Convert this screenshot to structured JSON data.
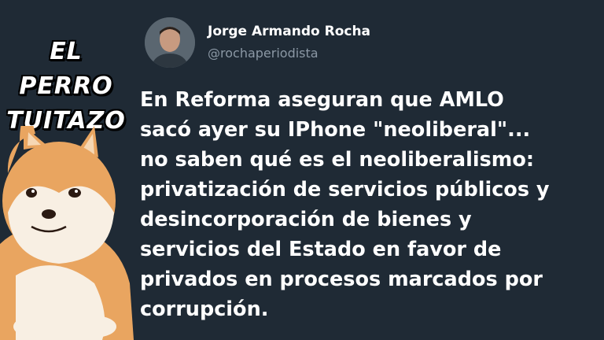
{
  "brand": {
    "line1": "EL PERRO",
    "line2": "TUITAZO"
  },
  "user": {
    "name": "Jorge Armando Rocha",
    "handle": "@rochaperiodista"
  },
  "tweet": {
    "lines": [
      "En Reforma aseguran que AMLO",
      "sacó ayer su IPhone \"neoliberal\"...",
      "no saben qué es el neoliberalismo:",
      "privatización de servicios públicos y",
      "desincorporación de bienes y",
      "servicios del Estado en favor de",
      "privados en procesos marcados por",
      "corrupción."
    ]
  },
  "colors": {
    "background": "#1f2a35",
    "text": "#ffffff",
    "handle": "#8b98a5",
    "dog_fur": "#e9a560"
  }
}
